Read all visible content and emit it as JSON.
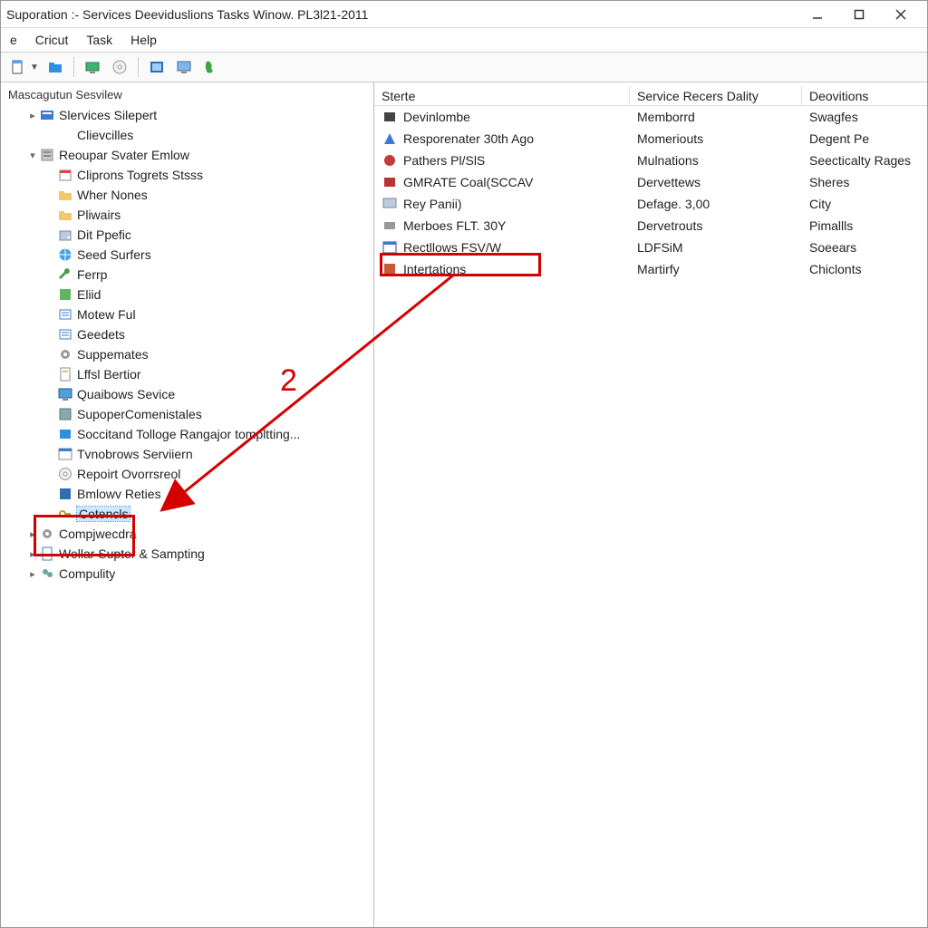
{
  "window": {
    "title": "Suporation :- Services Deeviduslions Tasks Winow. PL3l21-2011"
  },
  "menubar": {
    "items": [
      "e",
      "Cricut",
      "Task",
      "Help"
    ]
  },
  "toolbar": {
    "icons": [
      "doc-dropdown",
      "folder",
      "desktop",
      "cd",
      "picture",
      "monitor",
      "run"
    ]
  },
  "tree": {
    "title": "Mascagutun Sesvilew",
    "root_items": [
      {
        "label": "Slervices Silepert",
        "icon": "services",
        "indent": 1,
        "twist": "▸"
      },
      {
        "label": "Clievcilles",
        "icon": "",
        "indent": 2
      },
      {
        "label": "Reoupar Svater Emlow",
        "icon": "server",
        "indent": 1,
        "twist": "▾"
      },
      {
        "label": "Cliprons Togrets Stsss",
        "icon": "cal",
        "indent": 2
      },
      {
        "label": "Wher Nones",
        "icon": "folder",
        "indent": 2
      },
      {
        "label": "Pliwairs",
        "icon": "folder",
        "indent": 2
      },
      {
        "label": "Dit Ppefic",
        "icon": "disk",
        "indent": 2
      },
      {
        "label": "Seed Surfers",
        "icon": "globe",
        "indent": 2
      },
      {
        "label": "Ferrp",
        "icon": "wrench",
        "indent": 2
      },
      {
        "label": "Eliid",
        "icon": "green",
        "indent": 2
      },
      {
        "label": "Motew Ful",
        "icon": "list",
        "indent": 2
      },
      {
        "label": "Geedets",
        "icon": "list",
        "indent": 2
      },
      {
        "label": "Suppemates",
        "icon": "gear",
        "indent": 2
      },
      {
        "label": "Lffsl Bertior",
        "icon": "doc",
        "indent": 2
      },
      {
        "label": "Quaibows Sevice",
        "icon": "monitor",
        "indent": 2
      },
      {
        "label": "SupoperComenistales",
        "icon": "server2",
        "indent": 2
      },
      {
        "label": "Soccitand Tolloge Rangajor tompltting...",
        "icon": "blue",
        "indent": 2
      },
      {
        "label": "Tvnobrows Serviiern",
        "icon": "window",
        "indent": 2
      },
      {
        "label": "Repoirt Ovorrsreol",
        "icon": "cd",
        "indent": 2
      },
      {
        "label": "Bmlowv Reties",
        "icon": "blue2",
        "indent": 2
      },
      {
        "label": "Cotencls",
        "icon": "key",
        "indent": 2,
        "selected": true
      },
      {
        "label": "Compjwecdra",
        "icon": "gear",
        "indent": 1,
        "twist": "▸"
      },
      {
        "label": "Wellar Supter & Sampting",
        "icon": "page",
        "indent": 1,
        "twist": "▸"
      },
      {
        "label": "Compulity",
        "icon": "users",
        "indent": 1,
        "twist": "▸"
      }
    ]
  },
  "list": {
    "columns": [
      "Sterte",
      "Service Recers Dality",
      "Deovitions"
    ],
    "rows": [
      {
        "name": "Devinlombe",
        "c1": "Memborrd",
        "c2": "Swagfes",
        "icon": "svc-dark"
      },
      {
        "name": "Resporenater 30th Ago",
        "c1": "Momeriouts",
        "c2": "Degent Pe",
        "icon": "svc-blue"
      },
      {
        "name": "Pathers Pl/SlS",
        "c1": "Mulnations",
        "c2": "Seecticalty Rages",
        "icon": "svc-red"
      },
      {
        "name": "GMRATE Coal(SCCAV",
        "c1": "Dervettews",
        "c2": "Sheres",
        "icon": "svc-red2"
      },
      {
        "name": "Rey Panii)",
        "c1": "Defage. 3,00",
        "c2": "City",
        "icon": "svc-mon"
      },
      {
        "name": "Merboes FLT. 30Y",
        "c1": "Dervetrouts",
        "c2": "Pimallls",
        "icon": "svc-gray"
      },
      {
        "name": "Rectllows FSV/W",
        "c1": "LDFSiM",
        "c2": "Soeears",
        "icon": "svc-win"
      },
      {
        "name": "Intertations",
        "c1": "Martirfy",
        "c2": "Chiclonts",
        "icon": "svc-book"
      }
    ]
  },
  "annotation": {
    "label": "2"
  }
}
